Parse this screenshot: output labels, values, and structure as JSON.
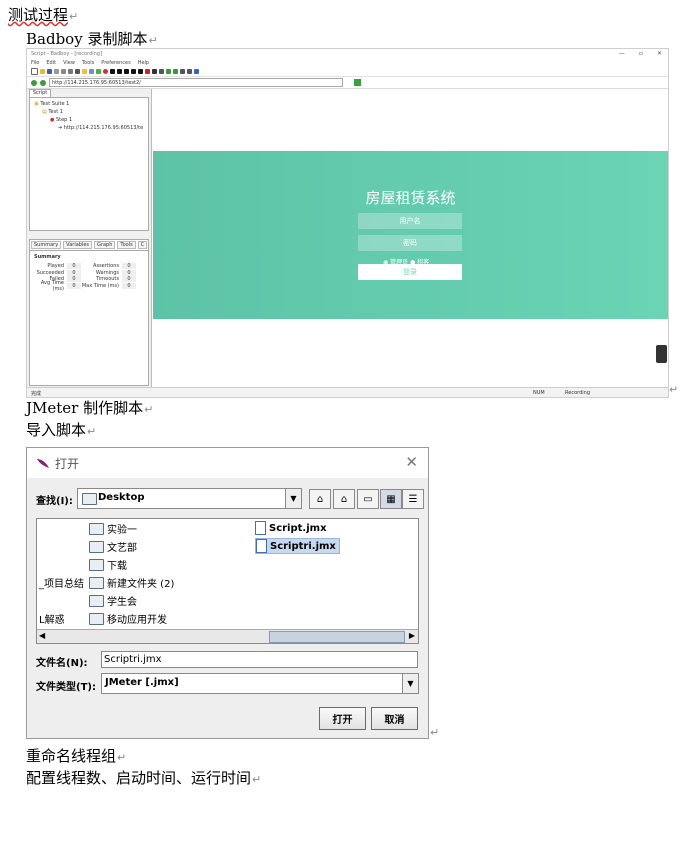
{
  "doc": {
    "heading_test_process": "测试过程",
    "heading_badboy": "Badboy 录制脚本",
    "heading_jmeter": "JMeter 制作脚本",
    "heading_import": "导入脚本",
    "heading_rename": "重命名线程组",
    "heading_config": "配置线程数、启动时间、运行时间",
    "return_mark": "↵"
  },
  "badboy": {
    "title": "Script - Badboy - [recording]",
    "menu": [
      "File",
      "Edit",
      "View",
      "Tools",
      "Preferences",
      "Help"
    ],
    "url": "http://114.215.176.95:60513/test2/",
    "tree_tab": "Script",
    "tree": {
      "suite": "Test Suite 1",
      "test": "Test 1",
      "step": "Step 1",
      "request": "http://114.215.176.95:60513/te"
    },
    "summary_tabs": [
      "Summary",
      "Variables",
      "Graph",
      "Tools",
      "C"
    ],
    "summary_heading": "Summary",
    "summary_rows": [
      {
        "label": "Played",
        "value": "0",
        "label2": "Assertions",
        "value2": "0"
      },
      {
        "label": "Succeeded",
        "value": "0",
        "label2": "Warnings",
        "value2": "0"
      },
      {
        "label": "Failed",
        "value": "0",
        "label2": "Timeouts",
        "value2": "0"
      },
      {
        "label": "Avg Time (ms)",
        "value": "0",
        "label2": "Max Time (ms)",
        "value2": "0"
      }
    ],
    "page": {
      "title": "房屋租赁系统",
      "username_placeholder": "用户名",
      "password_placeholder": "密码",
      "radio_admin": "管理员",
      "radio_tenant": "租客",
      "login_button": "登录"
    },
    "status": {
      "left": "完成",
      "num": "NUM",
      "recording": "Recording"
    }
  },
  "dialog": {
    "title": "打开",
    "look_in_label": "查找(I):",
    "look_in_value": "Desktop",
    "folders": [
      "实验一",
      "文艺部",
      "下载",
      "新建文件夹 (2)",
      "学生会",
      "移动应用开发"
    ],
    "cut_names": [
      "_项目总结",
      "L解惑"
    ],
    "files": [
      "Script.jmx",
      "Scriptri.jmx"
    ],
    "filename_label": "文件名(N):",
    "filename_value": "Scriptri.jmx",
    "filetype_label": "文件类型(T):",
    "filetype_value": "JMeter [.jmx]",
    "open_button": "打开",
    "cancel_button": "取消"
  },
  "colors": {
    "hero": "#5ec3a6",
    "selected": "#c7d9ef"
  }
}
